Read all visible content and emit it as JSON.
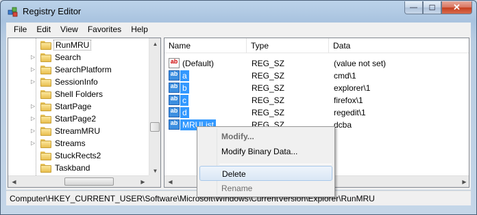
{
  "window": {
    "title": "Registry Editor",
    "icon": "registry-cubes-icon",
    "caption": {
      "minimize": "—",
      "maximize": "☐",
      "close": "✕"
    }
  },
  "menu": [
    "File",
    "Edit",
    "View",
    "Favorites",
    "Help"
  ],
  "tree": {
    "items": [
      {
        "label": "RunMRU",
        "expander": "",
        "selected": true
      },
      {
        "label": "Search",
        "expander": "▷"
      },
      {
        "label": "SearchPlatform",
        "expander": "▷"
      },
      {
        "label": "SessionInfo",
        "expander": "▷"
      },
      {
        "label": "Shell Folders",
        "expander": ""
      },
      {
        "label": "StartPage",
        "expander": "▷"
      },
      {
        "label": "StartPage2",
        "expander": "▷"
      },
      {
        "label": "StreamMRU",
        "expander": "▷"
      },
      {
        "label": "Streams",
        "expander": "▷"
      },
      {
        "label": "StuckRects2",
        "expander": ""
      },
      {
        "label": "Taskband",
        "expander": ""
      }
    ],
    "scroll_up": "▲",
    "scroll_down": "▼",
    "scroll_left": "◀",
    "scroll_right": "▶"
  },
  "values": {
    "columns": [
      "Name",
      "Type",
      "Data"
    ],
    "rows": [
      {
        "name": "(Default)",
        "type": "REG_SZ",
        "data": "(value not set)",
        "selected": false
      },
      {
        "name": "a",
        "type": "REG_SZ",
        "data": "cmd\\1",
        "selected": true
      },
      {
        "name": "b",
        "type": "REG_SZ",
        "data": "explorer\\1",
        "selected": true
      },
      {
        "name": "c",
        "type": "REG_SZ",
        "data": "firefox\\1",
        "selected": true
      },
      {
        "name": "d",
        "type": "REG_SZ",
        "data": "regedit\\1",
        "selected": true
      },
      {
        "name": "MRUList",
        "type": "REG_SZ",
        "data": "dcba",
        "selected": true
      }
    ],
    "icon_text": "ab",
    "scroll_left": "◀",
    "scroll_right": "▶"
  },
  "context_menu": {
    "items": [
      {
        "label": "Modify...",
        "state": "default-disabled"
      },
      {
        "label": "Modify Binary Data...",
        "state": "normal"
      },
      {
        "label": "Delete",
        "state": "hover"
      },
      {
        "label": "Rename",
        "state": "disabled"
      }
    ]
  },
  "status": {
    "path": "Computer\\HKEY_CURRENT_USER\\Software\\Microsoft\\Windows\\CurrentVersion\\Explorer\\RunMRU"
  }
}
